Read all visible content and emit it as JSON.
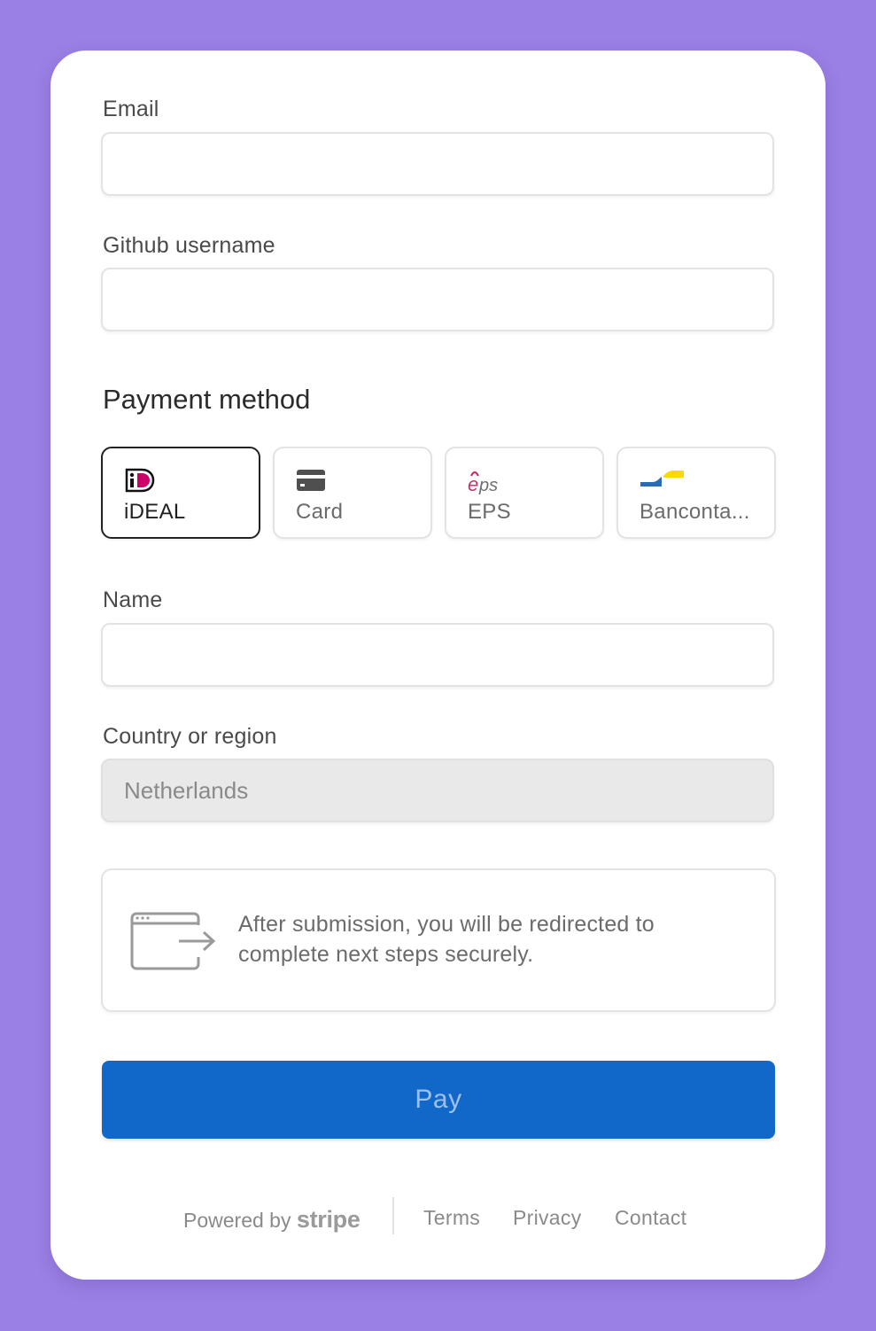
{
  "form": {
    "email_label": "Email",
    "email_value": "",
    "github_label": "Github username",
    "github_value": "",
    "payment_title": "Payment method",
    "name_label": "Name",
    "name_value": "",
    "country_label": "Country or region",
    "country_value": "Netherlands"
  },
  "payment_methods": [
    {
      "label": "iDEAL",
      "icon": "ideal-icon",
      "selected": true
    },
    {
      "label": "Card",
      "icon": "card-icon",
      "selected": false
    },
    {
      "label": "EPS",
      "icon": "eps-icon",
      "selected": false
    },
    {
      "label": "Banconta...",
      "icon": "bancontact-icon",
      "selected": false
    }
  ],
  "notice": {
    "text": "After submission, you will be redirected to complete next steps securely.",
    "icon": "redirect-browser-icon"
  },
  "pay_button": {
    "label": "Pay"
  },
  "footer": {
    "powered_by": "Powered by",
    "brand": "stripe",
    "links": [
      "Terms",
      "Privacy",
      "Contact"
    ]
  },
  "colors": {
    "page_background": "#9a80e4",
    "accent": "#1168c8",
    "ideal_pink": "#cc0066",
    "eps_pink": "#c8336e",
    "bancontact_blue": "#2a6bb5",
    "bancontact_yellow": "#ffd800"
  }
}
